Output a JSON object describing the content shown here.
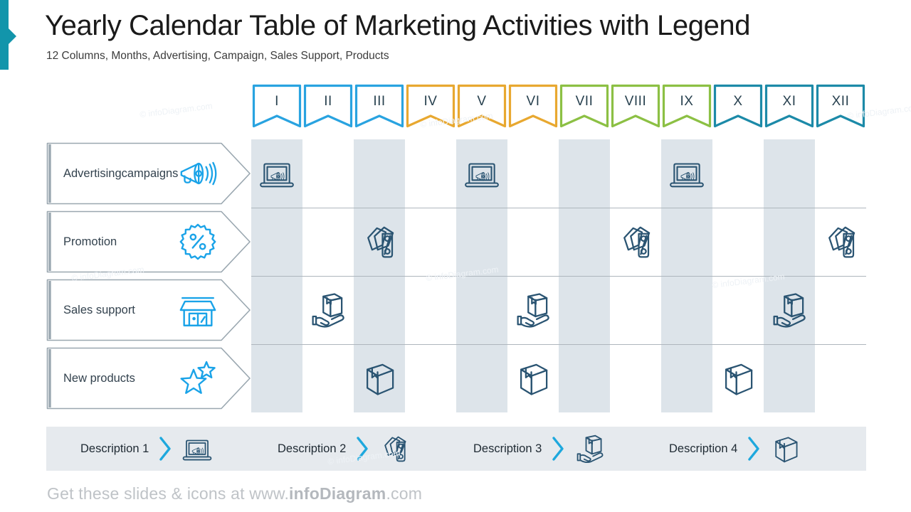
{
  "header": {
    "title": "Yearly Calendar Table of Marketing Activities with Legend",
    "subtitle": "12 Columns, Months, Advertising, Campaign, Sales Support, Products"
  },
  "colors": {
    "accent_teal": "#1295ab",
    "month_blue": "#29a3e0",
    "month_amber": "#e8a830",
    "month_green": "#8cc044",
    "month_teal": "#1c8aa8",
    "stripe": "#dde4ea",
    "icon_navy": "#2a5472",
    "icon_blue": "#1aa3e8",
    "legend_bg": "#e6eaee",
    "label_border": "#9aa7b0",
    "footer_gray": "#bfc3c7"
  },
  "months": [
    {
      "label": "I",
      "color_key": "month_blue"
    },
    {
      "label": "II",
      "color_key": "month_blue"
    },
    {
      "label": "III",
      "color_key": "month_blue"
    },
    {
      "label": "IV",
      "color_key": "month_amber"
    },
    {
      "label": "V",
      "color_key": "month_amber"
    },
    {
      "label": "VI",
      "color_key": "month_amber"
    },
    {
      "label": "VII",
      "color_key": "month_green"
    },
    {
      "label": "VIII",
      "color_key": "month_green"
    },
    {
      "label": "IX",
      "color_key": "month_green"
    },
    {
      "label": "X",
      "color_key": "month_teal"
    },
    {
      "label": "XI",
      "color_key": "month_teal"
    },
    {
      "label": "XII",
      "color_key": "month_teal"
    }
  ],
  "rows": [
    {
      "label": "Advertising\ncampaigns",
      "icon": "megaphone-icon",
      "cell_icon": "laptop-megaphone-icon",
      "months": [
        1,
        5,
        9
      ]
    },
    {
      "label": "Promotion",
      "icon": "percent-badge-icon",
      "cell_icon": "price-tags-icon",
      "months": [
        3,
        8,
        12
      ]
    },
    {
      "label": "Sales support",
      "icon": "shop-icon",
      "cell_icon": "hand-box-icon",
      "months": [
        2,
        6,
        11
      ]
    },
    {
      "label": "New products",
      "icon": "stars-icon",
      "cell_icon": "box-icon",
      "months": [
        3,
        6,
        10
      ]
    }
  ],
  "legend": [
    {
      "label": "Description 1",
      "icon": "laptop-megaphone-icon"
    },
    {
      "label": "Description 2",
      "icon": "price-tags-icon"
    },
    {
      "label": "Description 3",
      "icon": "hand-box-icon"
    },
    {
      "label": "Description 4",
      "icon": "box-icon"
    }
  ],
  "footer": {
    "prefix": "Get these slides & icons at www.",
    "brand": "infoDiagram",
    "suffix": ".com"
  },
  "watermark": "© infoDiagram.com"
}
